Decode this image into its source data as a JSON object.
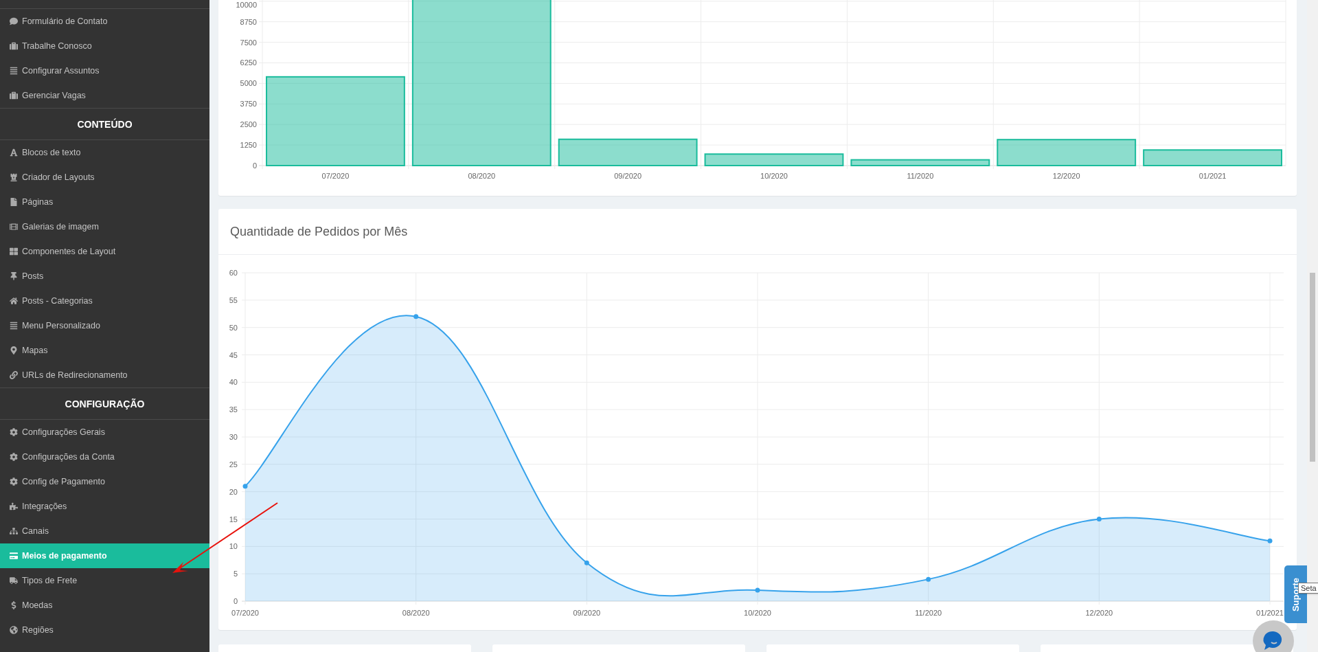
{
  "sidebar": {
    "sections": [
      {
        "items": [
          {
            "label": "Formulário de Contato",
            "selected": false
          },
          {
            "label": "Trabalhe Conosco",
            "selected": false
          },
          {
            "label": "Configurar Assuntos",
            "selected": false
          },
          {
            "label": "Gerenciar Vagas",
            "selected": false
          }
        ]
      },
      {
        "heading": "CONTEÚDO",
        "items": [
          {
            "label": "Blocos de texto",
            "selected": false
          },
          {
            "label": "Criador de Layouts",
            "selected": false
          },
          {
            "label": "Páginas",
            "selected": false
          },
          {
            "label": "Galerias de imagem",
            "selected": false
          },
          {
            "label": "Componentes de Layout",
            "selected": false
          },
          {
            "label": "Posts",
            "selected": false
          },
          {
            "label": "Posts - Categorias",
            "selected": false
          },
          {
            "label": "Menu Personalizado",
            "selected": false
          },
          {
            "label": "Mapas",
            "selected": false
          },
          {
            "label": "URLs de Redirecionamento",
            "selected": false
          }
        ]
      },
      {
        "heading": "CONFIGURAÇÃO",
        "items": [
          {
            "label": "Configurações Gerais",
            "selected": false
          },
          {
            "label": "Configurações da Conta",
            "selected": false
          },
          {
            "label": "Config de Pagamento",
            "selected": false
          },
          {
            "label": "Integrações",
            "selected": false
          },
          {
            "label": "Canais",
            "selected": false
          },
          {
            "label": "Meios de pagamento",
            "selected": true
          },
          {
            "label": "Tipos de Frete",
            "selected": false
          },
          {
            "label": "Moedas",
            "selected": false
          },
          {
            "label": "Regiões",
            "selected": false
          }
        ]
      }
    ]
  },
  "bar_panel": {
    "chart_data": {
      "type": "bar",
      "categories": [
        "07/2020",
        "08/2020",
        "09/2020",
        "10/2020",
        "11/2020",
        "12/2020",
        "01/2021"
      ],
      "series": [
        {
          "color": "#1abc9c",
          "values": [
            5400,
            10200,
            1600,
            700,
            350,
            1580,
            950
          ]
        }
      ],
      "grid": true,
      "ylim": [
        0,
        10200
      ],
      "yticks": [
        0,
        1250,
        2500,
        3750,
        5000,
        6250,
        7500,
        8750,
        10000
      ]
    }
  },
  "line_panel": {
    "title": "Quantidade de Pedidos por Mês",
    "chart_data": {
      "type": "area",
      "categories": [
        "07/2020",
        "08/2020",
        "09/2020",
        "10/2020",
        "11/2020",
        "12/2020",
        "01/2021"
      ],
      "series": [
        {
          "color": "#36a2eb",
          "values": [
            21,
            52,
            7,
            2,
            4,
            15,
            11
          ]
        }
      ],
      "grid": true,
      "ylim": [
        0,
        60
      ],
      "yticks": [
        0,
        5,
        10,
        15,
        20,
        25,
        30,
        35,
        40,
        45,
        50,
        55,
        60
      ]
    }
  },
  "bottom_cards": [
    {
      "kind": "card"
    },
    {
      "kind": "card"
    },
    {
      "kind": "card"
    },
    {
      "kind": "card"
    }
  ],
  "support_tab": {
    "label": "Suporte"
  },
  "tooltip": {
    "text": "Seta"
  }
}
